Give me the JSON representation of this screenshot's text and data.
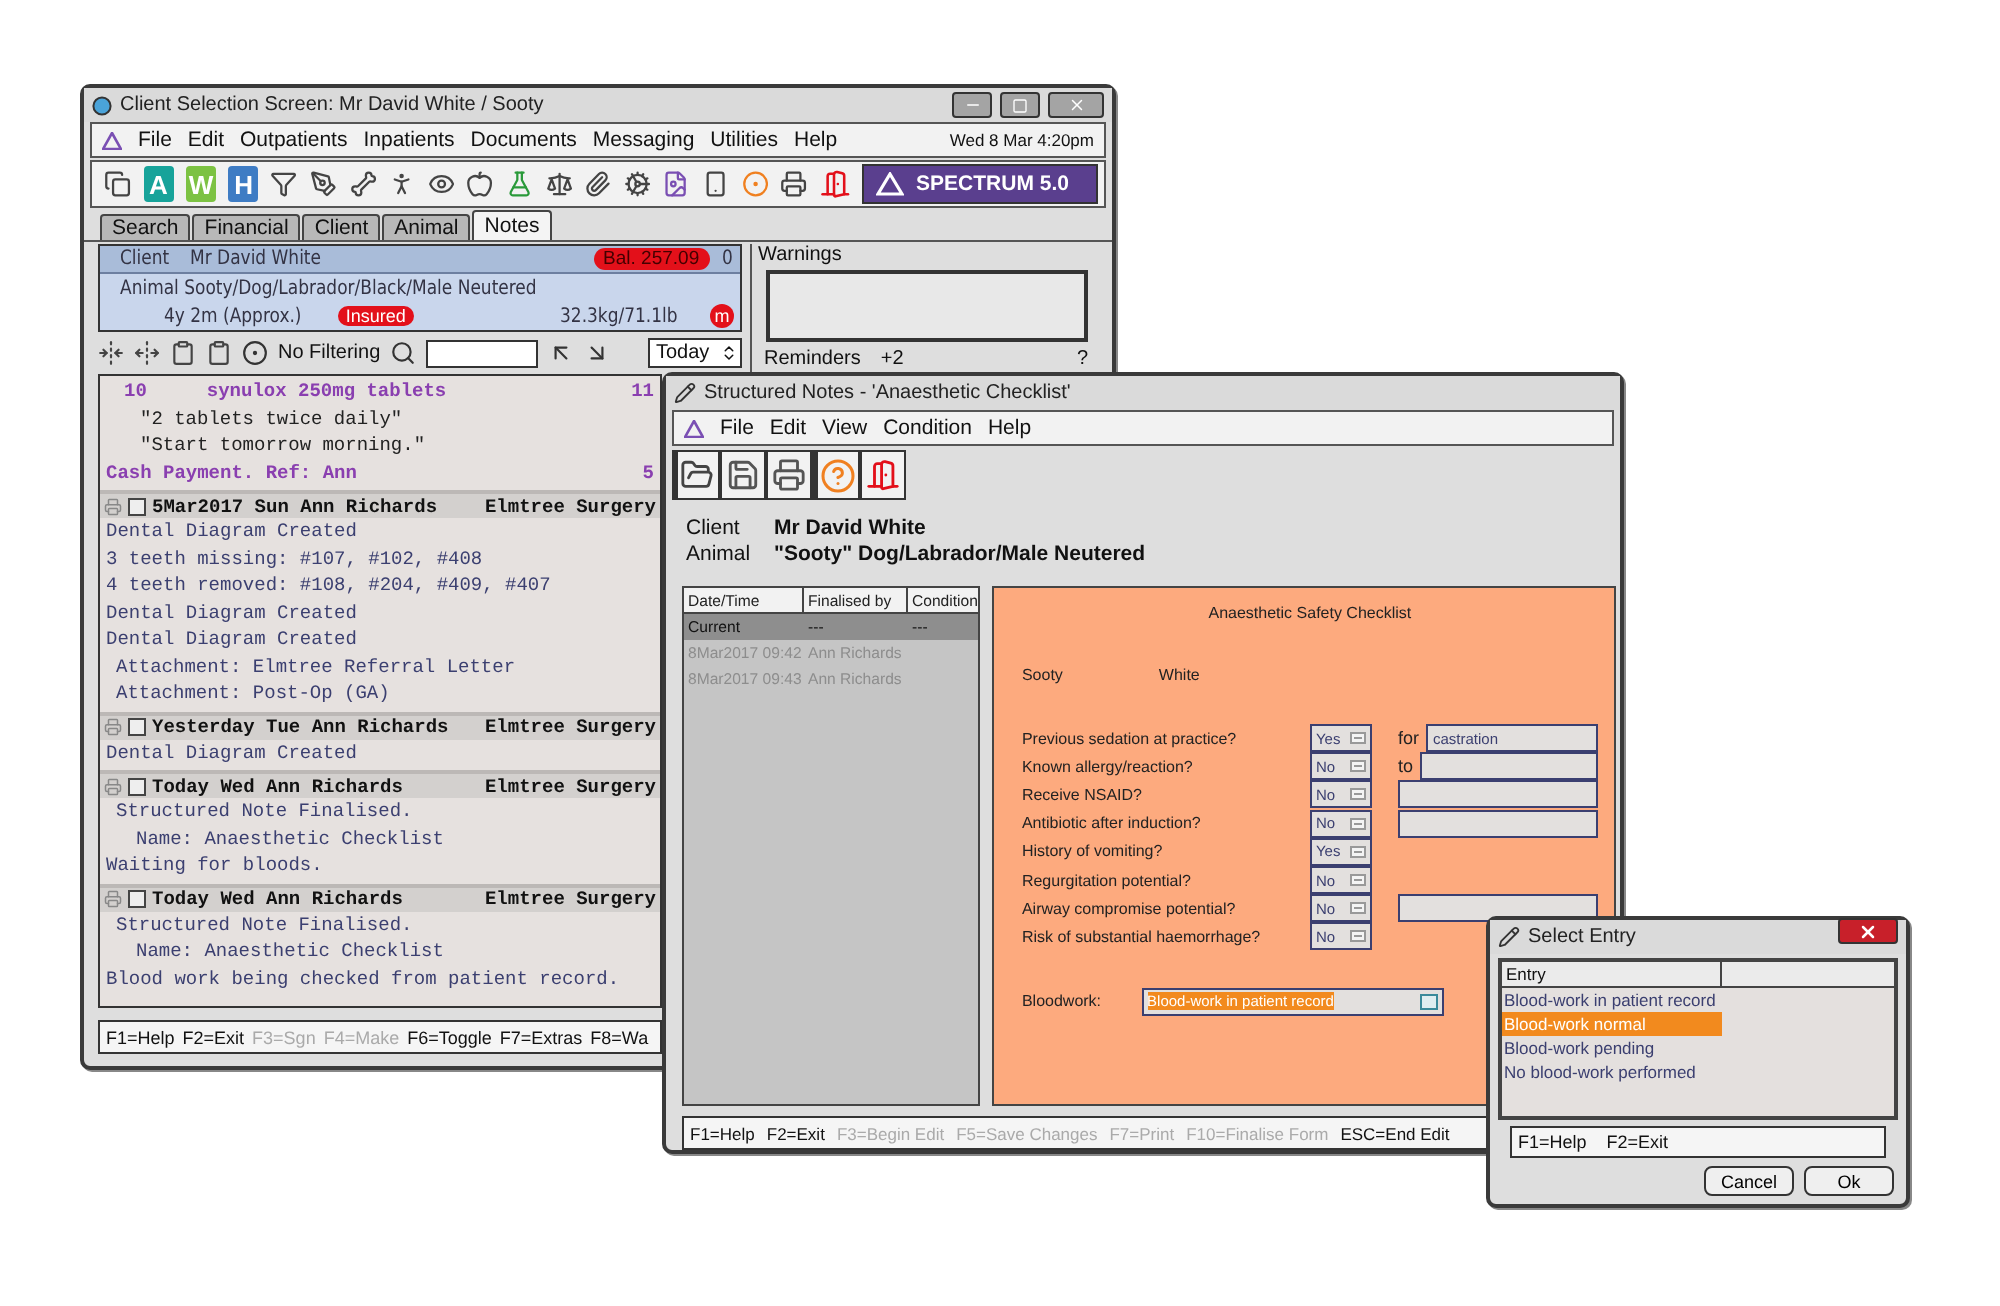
{
  "main_window": {
    "title": "Client Selection Screen: Mr David White / Sooty",
    "menu": [
      "File",
      "Edit",
      "Outpatients",
      "Inpatients",
      "Documents",
      "Messaging",
      "Utilities",
      "Help"
    ],
    "clock": "Wed 8 Mar 4:20pm",
    "letter_buttons": [
      {
        "label": "A",
        "color": "#17a39a"
      },
      {
        "label": "W",
        "color": "#7cc242"
      },
      {
        "label": "H",
        "color": "#3e7cc4"
      }
    ],
    "brand": "SPECTRUM 5.0",
    "tabs": [
      {
        "label": "Search",
        "selected": false
      },
      {
        "label": "Financial",
        "selected": false
      },
      {
        "label": "Client",
        "selected": false
      },
      {
        "label": "Animal",
        "selected": false
      },
      {
        "label": "Notes",
        "selected": true
      }
    ],
    "client": {
      "label": "Client",
      "name": "Mr David White",
      "balance": "Bal.  257.09",
      "count": "0"
    },
    "animal": {
      "description": "Animal Sooty/Dog/Labrador/Black/Male Neutered",
      "age": "4y 2m (Approx.)",
      "insured": "Insured",
      "weight": "32.3kg/71.1lb",
      "marker": "m"
    },
    "filter": {
      "label": "No Filtering",
      "period": "Today"
    },
    "warnings": {
      "title": "Warnings"
    },
    "reminders": {
      "label": "Reminders",
      "count": "+2",
      "help": "?"
    },
    "notes": [
      {
        "lines": [
          {
            "kind": "item",
            "cells": [
              "10",
              "synulox 250mg tablets",
              "11"
            ]
          },
          {
            "kind": "quote",
            "text": "\"2 tablets twice daily\""
          },
          {
            "kind": "quote",
            "text": "\"Start tomorrow morning.\""
          },
          {
            "kind": "payment",
            "cells": [
              "Cash Payment. Ref: Ann",
              "5"
            ]
          }
        ]
      },
      {
        "header": {
          "title": "5Mar2017 Sun Ann Richards",
          "place": "Elmtree Surgery",
          "checked": false
        },
        "lines": [
          {
            "kind": "text",
            "text": "Dental Diagram Created"
          },
          {
            "kind": "text",
            "text": "3 teeth missing: #107, #102, #408"
          },
          {
            "kind": "text",
            "text": "4 teeth removed: #108, #204, #409, #407"
          },
          {
            "kind": "text",
            "text": "Dental Diagram Created"
          },
          {
            "kind": "text",
            "text": "Dental Diagram Created"
          },
          {
            "kind": "sub",
            "text": "Attachment: Elmtree Referral Letter"
          },
          {
            "kind": "sub",
            "text": "Attachment: Post-Op (GA)"
          }
        ]
      },
      {
        "header": {
          "title": "Yesterday Tue Ann Richards",
          "place": "Elmtree Surgery",
          "checked": false
        },
        "lines": [
          {
            "kind": "text",
            "text": "Dental Diagram Created"
          }
        ]
      },
      {
        "header": {
          "title": "Today Wed Ann Richards",
          "place": "Elmtree Surgery",
          "checked": false
        },
        "lines": [
          {
            "kind": "sub",
            "text": "Structured Note Finalised."
          },
          {
            "kind": "detail",
            "text": "Name: Anaesthetic Checklist"
          },
          {
            "kind": "text",
            "text": "Waiting for bloods."
          }
        ]
      },
      {
        "header": {
          "title": "Today Wed Ann Richards",
          "place": "Elmtree Surgery",
          "checked": false
        },
        "lines": [
          {
            "kind": "sub",
            "text": "Structured Note Finalised."
          },
          {
            "kind": "detail",
            "text": "Name: Anaesthetic Checklist"
          },
          {
            "kind": "text",
            "text": "Blood work being checked from patient record."
          }
        ]
      }
    ],
    "function_keys": [
      {
        "label": "F1=Help",
        "disabled": false
      },
      {
        "label": "F2=Exit",
        "disabled": false
      },
      {
        "label": "F3=Sgn",
        "disabled": true
      },
      {
        "label": "F4=Make",
        "disabled": true
      },
      {
        "label": "F6=Toggle",
        "disabled": false
      },
      {
        "label": "F7=Extras",
        "disabled": false
      },
      {
        "label": "F8=Wa",
        "disabled": false
      }
    ]
  },
  "notes_window": {
    "title": "Structured Notes - 'Anaesthetic Checklist'",
    "menu": [
      "File",
      "Edit",
      "View",
      "Condition",
      "Help"
    ],
    "client_label": "Client",
    "client": "Mr David White",
    "animal_label": "Animal",
    "animal": "\"Sooty\" Dog/Labrador/Male Neutered",
    "history": {
      "columns": [
        "Date/Time",
        "Finalised by",
        "Condition"
      ],
      "rows": [
        {
          "cells": [
            "Current",
            "---",
            "---"
          ],
          "selected": true
        },
        {
          "cells": [
            "8Mar2017 09:42",
            "Ann Richards"
          ],
          "selected": false
        },
        {
          "cells": [
            "8Mar2017 09:43",
            "Ann Richards"
          ],
          "selected": false
        }
      ]
    },
    "form": {
      "title": "Anaesthetic Safety Checklist",
      "animal": "Sooty",
      "surname": "White",
      "questions": [
        {
          "kind": "field",
          "label": "Previous sedation at practice?",
          "answer": "Yes",
          "field_label": "for",
          "field_value": "castration"
        },
        {
          "kind": "field",
          "label": "Known allergy/reaction?",
          "answer": "No",
          "field_label": "to"
        },
        {
          "kind": "field",
          "label": "Receive NSAID?",
          "answer": "No"
        },
        {
          "kind": "field",
          "label": "Antibiotic after induction?",
          "answer": "No"
        },
        {
          "kind": "plain",
          "label": "History of vomiting?",
          "answer": "Yes"
        },
        {
          "kind": "plain",
          "label": "Regurgitation potential?",
          "answer": "No"
        },
        {
          "kind": "field",
          "label": "Airway compromise potential?",
          "answer": "No"
        },
        {
          "kind": "plain",
          "label": "Risk of substantial haemorrhage?",
          "answer": "No"
        }
      ],
      "bloodwork": {
        "label": "Bloodwork:",
        "value": "Blood-work in patient record",
        "highlighted": true
      }
    },
    "function_keys": [
      {
        "label": "F1=Help",
        "disabled": false
      },
      {
        "label": "F2=Exit",
        "disabled": false
      },
      {
        "label": "F3=Begin Edit",
        "disabled": true
      },
      {
        "label": "F5=Save Changes",
        "disabled": true
      },
      {
        "label": "F7=Print",
        "disabled": true
      },
      {
        "label": "F10=Finalise Form",
        "disabled": true
      },
      {
        "label": "ESC=End Edit",
        "disabled": false
      }
    ]
  },
  "select_window": {
    "title": "Select Entry",
    "column": "Entry",
    "entries": [
      {
        "label": "Blood-work in patient record",
        "selected": false
      },
      {
        "label": "Blood-work normal",
        "selected": true
      },
      {
        "label": "Blood-work pending",
        "selected": false
      },
      {
        "label": "No blood-work performed",
        "selected": false
      }
    ],
    "function_keys": [
      "F1=Help",
      "F2=Exit"
    ],
    "buttons": [
      "Cancel",
      "Ok"
    ]
  }
}
